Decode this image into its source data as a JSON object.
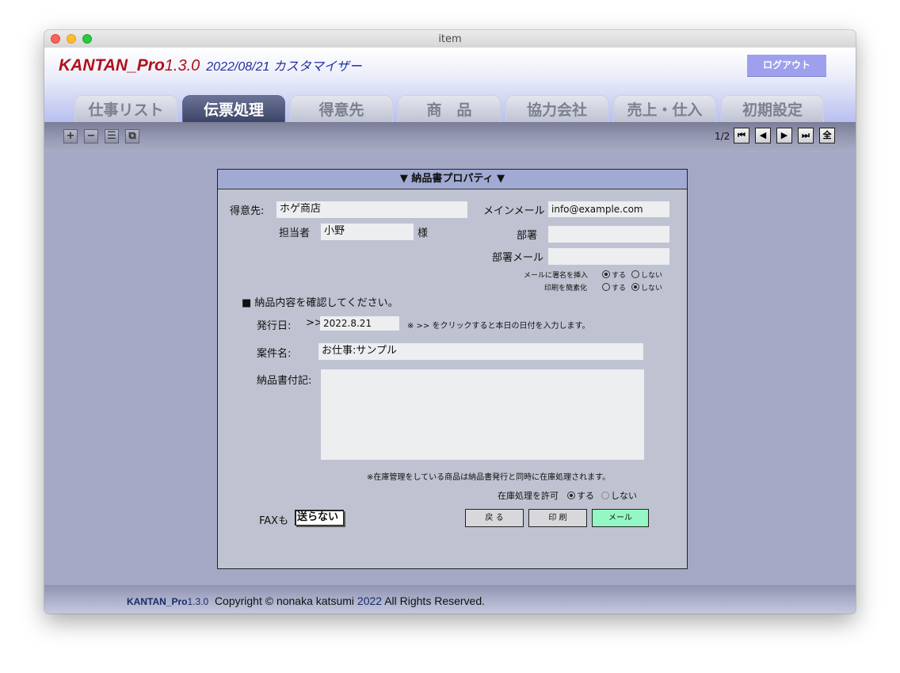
{
  "window": {
    "title": "item"
  },
  "header": {
    "app_name": "KANTAN_Pro",
    "app_version": "1.3.0",
    "subtitle": "2022/08/21 カスタマイザー",
    "logout_label": "ログアウト"
  },
  "tabs": [
    {
      "label": "仕事リスト",
      "active": false
    },
    {
      "label": "伝票処理",
      "active": true
    },
    {
      "label": "得意先",
      "active": false
    },
    {
      "label": "商　品",
      "active": false
    },
    {
      "label": "協力会社",
      "active": false
    },
    {
      "label": "売上・仕入",
      "active": false
    },
    {
      "label": "初期設定",
      "active": false
    }
  ],
  "toolbar": {
    "add_icon": "+",
    "remove_icon": "−",
    "list_icon": "☰",
    "copy_icon": "⧉",
    "record_position": "1/2",
    "first_icon": "⏮",
    "prev_icon": "◀",
    "next_icon": "▶",
    "last_icon": "⏭",
    "all_label": "全"
  },
  "panel": {
    "heading": "▼ 納品書プロパティ ▼",
    "customer_label": "得意先:",
    "customer_value": "ホゲ商店",
    "contact_label": "担当者",
    "contact_value": "小野",
    "honorific": "様",
    "main_email_label": "メインメール",
    "main_email_value": "info@example.com",
    "department_label": "部署",
    "department_value": "",
    "dept_email_label": "部署メール",
    "dept_email_value": "",
    "signature_label": "メールに署名を挿入",
    "signature_yes": "する",
    "signature_no": "しない",
    "simple_print_label": "印刷を簡素化",
    "simple_print_yes": "する",
    "simple_print_no": "しない",
    "confirm_heading": "■ 納品内容を確認してください。",
    "issue_date_label": "発行日:",
    "date_shortcut": ">>",
    "issue_date_value": "2022.8.21",
    "date_note": "※ >> をクリックすると本日の日付を入力します。",
    "job_name_label": "案件名:",
    "job_name_value": "お仕事:サンプル",
    "notes_label": "納品書付記:",
    "notes_value": "",
    "inventory_note": "※在庫管理をしている商品は納品書発行と同時に在庫処理されます。",
    "inventory_label": "在庫処理を許可",
    "inventory_yes": "する",
    "inventory_no": "しない",
    "fax_label": "FAXも",
    "fax_value": "送らない",
    "back_button": "戻 る",
    "print_button": "印 刷",
    "mail_button": "メール"
  },
  "footer": {
    "app_name": "KANTAN_Pro",
    "app_version": "1.3.0",
    "copyright_prefix": "Copyright © nonaka katsumi",
    "year": "2022",
    "rights": "All Rights Reserved."
  }
}
